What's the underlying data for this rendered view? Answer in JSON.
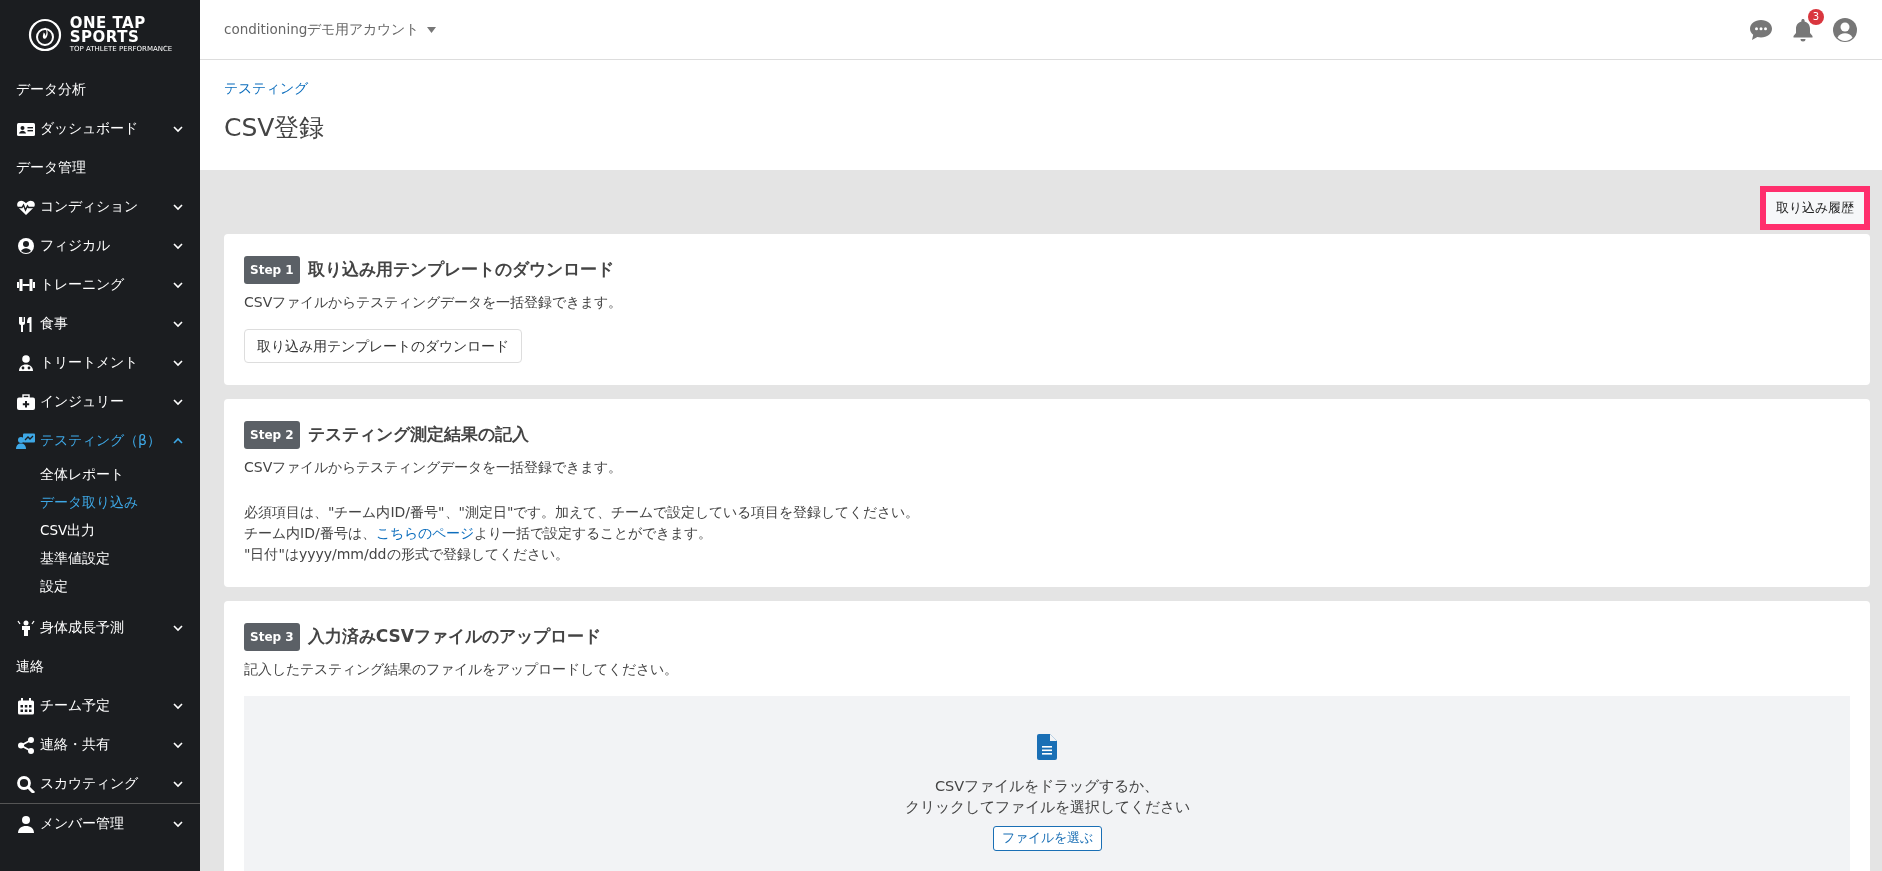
{
  "logo": {
    "lines": [
      "ONE TAP",
      "SPORTS"
    ],
    "tagline": "TOP ATHLETE PERFORMANCE"
  },
  "header": {
    "account": "conditioningデモ用アカウント",
    "notification_count": "3"
  },
  "sidebar": {
    "items": [
      {
        "kind": "heading",
        "label": "データ分析"
      },
      {
        "kind": "menu",
        "label": "ダッシュボード",
        "selected": false,
        "expanded": false
      },
      {
        "kind": "heading",
        "label": "データ管理"
      },
      {
        "kind": "menu",
        "label": "コンディション",
        "selected": false,
        "expanded": false
      },
      {
        "kind": "menu",
        "label": "フィジカル",
        "selected": false,
        "expanded": false
      },
      {
        "kind": "menu",
        "label": "トレーニング",
        "selected": false,
        "expanded": false
      },
      {
        "kind": "menu",
        "label": "食事",
        "selected": false,
        "expanded": false
      },
      {
        "kind": "menu",
        "label": "トリートメント",
        "selected": false,
        "expanded": false
      },
      {
        "kind": "menu",
        "label": "インジュリー",
        "selected": false,
        "expanded": false
      },
      {
        "kind": "menu",
        "label": "テスティング（β）",
        "selected": true,
        "expanded": true,
        "children": [
          {
            "label": "全体レポート",
            "selected": false
          },
          {
            "label": "データ取り込み",
            "selected": true
          },
          {
            "label": "CSV出力",
            "selected": false
          },
          {
            "label": "基準値設定",
            "selected": false
          },
          {
            "label": "設定",
            "selected": false
          }
        ]
      },
      {
        "kind": "menu",
        "label": "身体成長予測",
        "selected": false,
        "expanded": false
      },
      {
        "kind": "heading",
        "label": "連絡"
      },
      {
        "kind": "menu",
        "label": "チーム予定",
        "selected": false,
        "expanded": false
      },
      {
        "kind": "menu",
        "label": "連絡・共有",
        "selected": false,
        "expanded": false
      },
      {
        "kind": "menu",
        "label": "スカウティング",
        "selected": false,
        "expanded": false
      },
      {
        "kind": "menu",
        "label": "メンバー管理",
        "selected": false,
        "expanded": false
      }
    ]
  },
  "breadcrumb": "テスティング",
  "title": "CSV登録",
  "history_button": "取り込み履歴",
  "steps": [
    {
      "badge": "Step 1",
      "title": "取り込み用テンプレートのダウンロード",
      "description": "CSVファイルからテスティングデータを一括登録できます。",
      "button": "取り込み用テンプレートのダウンロード"
    },
    {
      "badge": "Step 2",
      "title": "テスティング測定結果の記入",
      "description": "CSVファイルからテスティングデータを一括登録できます。",
      "notes": [
        {
          "text": "必須項目は、\"チーム内ID/番号\"、\"測定日\"です。加えて、チームで設定している項目を登録してください。"
        },
        {
          "text": "チーム内ID/番号は、",
          "link": "こちらのページ",
          "after": "より一括で設定することができます。"
        },
        {
          "text": "\"日付\"はyyyy/mm/ddの形式で登録してください。"
        }
      ]
    },
    {
      "badge": "Step 3",
      "title": "入力済みCSVファイルのアップロード",
      "description": "記入したテスティング結果のファイルをアップロードしてください。",
      "dropzone": {
        "lines": [
          "CSVファイルをドラッグするか、",
          "クリックしてファイルを選択してください"
        ],
        "button": "ファイルを選ぶ"
      }
    }
  ]
}
